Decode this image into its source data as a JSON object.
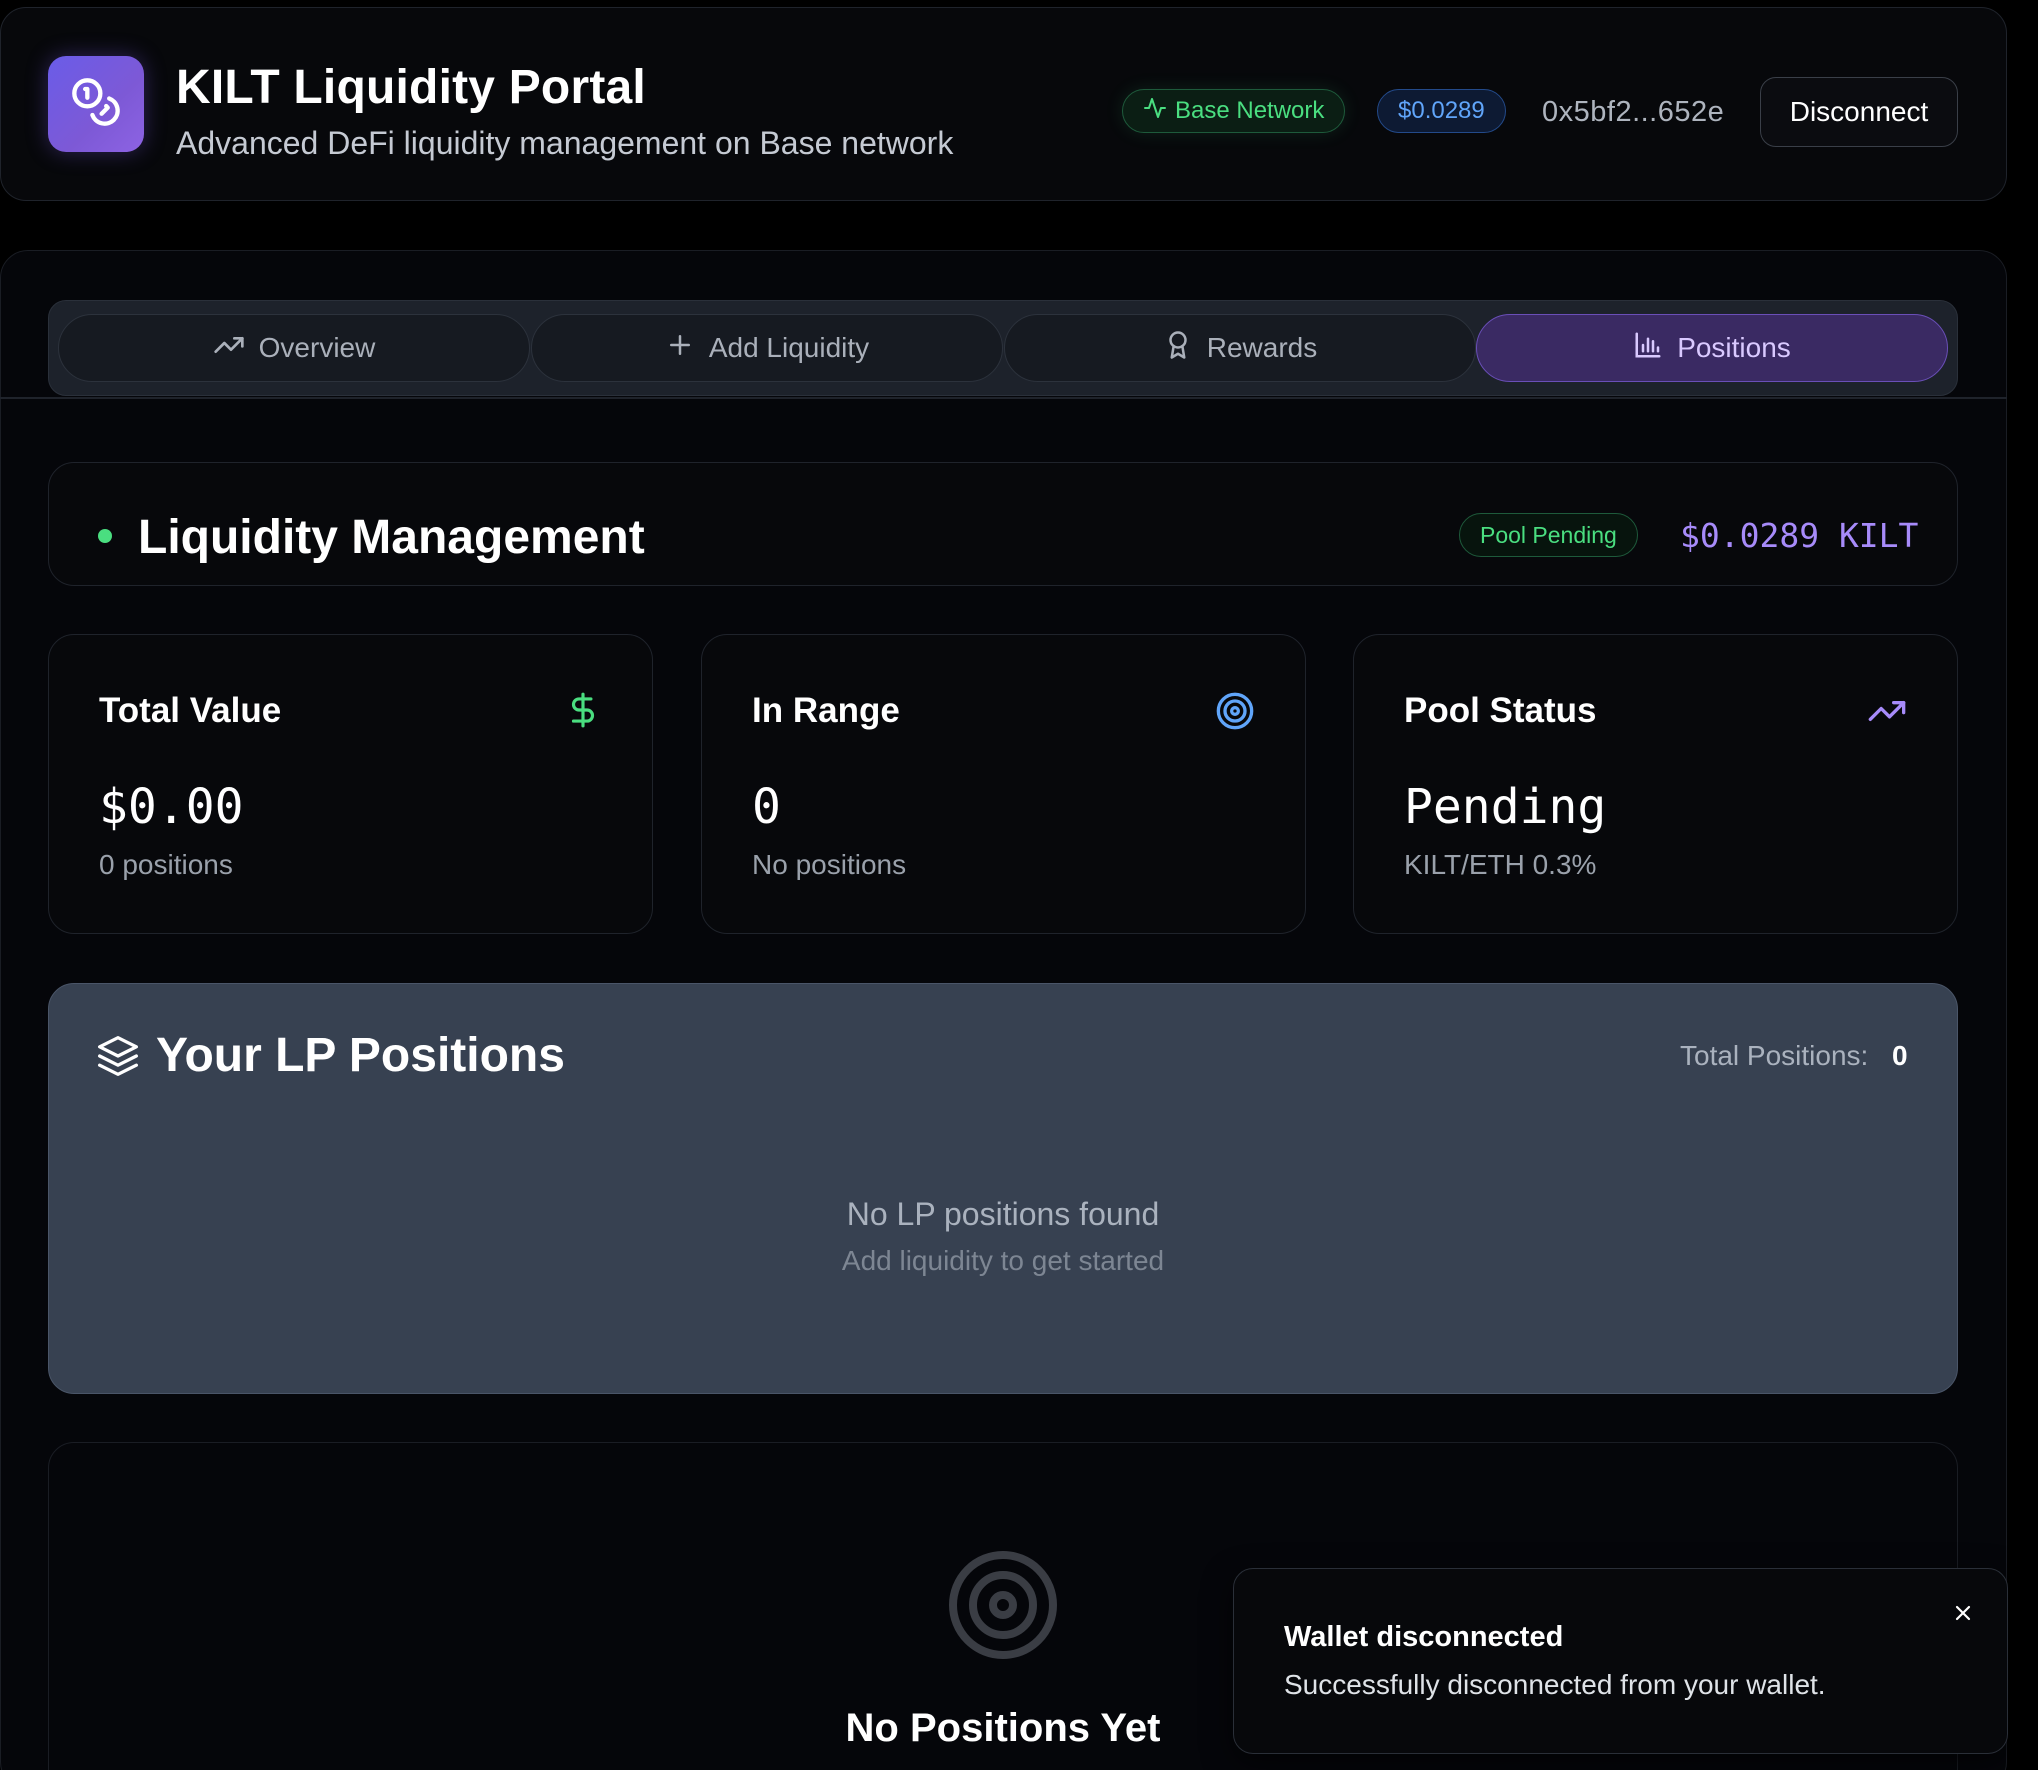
{
  "header": {
    "title": "KILT Liquidity Portal",
    "subtitle": "Advanced DeFi liquidity management on Base network",
    "network_badge": "Base Network",
    "price_badge": "$0.0289",
    "wallet_address": "0x5bf2...652e",
    "disconnect_label": "Disconnect",
    "logo_icon": "coins-icon"
  },
  "tabs": [
    {
      "label": "Overview",
      "icon": "trending-up-icon",
      "active": false
    },
    {
      "label": "Add Liquidity",
      "icon": "plus-icon",
      "active": false
    },
    {
      "label": "Rewards",
      "icon": "award-icon",
      "active": false
    },
    {
      "label": "Positions",
      "icon": "bar-chart-icon",
      "active": true
    }
  ],
  "liquidity_management": {
    "title": "Liquidity Management",
    "pool_badge": "Pool Pending",
    "price": "$0.0289 KILT"
  },
  "stats": [
    {
      "title": "Total Value",
      "value": "$0.00",
      "sub": "0 positions",
      "icon": "dollar-icon",
      "icon_color": "#4ade80"
    },
    {
      "title": "In Range",
      "value": "0",
      "sub": "No positions",
      "icon": "target-icon",
      "icon_color": "#60a5fa"
    },
    {
      "title": "Pool Status",
      "value": "Pending",
      "sub": "KILT/ETH 0.3%",
      "icon": "trending-up-icon",
      "icon_color": "#a78bfa"
    }
  ],
  "lp_positions": {
    "title": "Your LP Positions",
    "total_label": "Total Positions:",
    "total_value": "0",
    "empty_title": "No LP positions found",
    "empty_sub": "Add liquidity to get started"
  },
  "bottom": {
    "title": "No Positions Yet"
  },
  "toast": {
    "title": "Wallet disconnected",
    "message": "Successfully disconnected from your wallet."
  },
  "colors": {
    "accent_purple": "#a78bfa",
    "success_green": "#4ade80",
    "info_blue": "#60a5fa"
  }
}
